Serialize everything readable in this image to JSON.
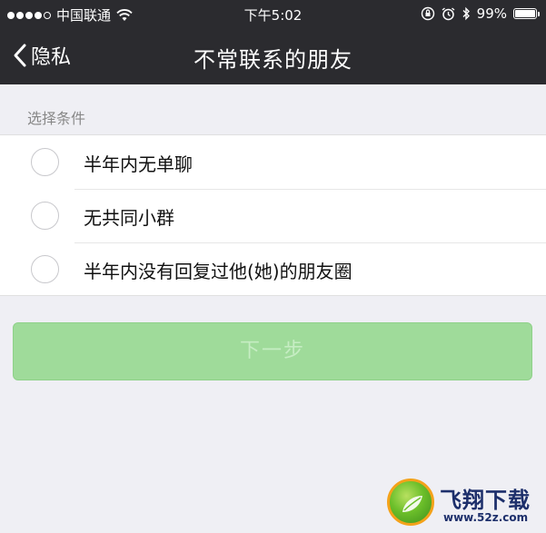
{
  "status_bar": {
    "carrier": "中国联通",
    "time": "下午5:02",
    "battery": "99%",
    "battery_level": 0.99,
    "signal_bars": 5,
    "signal_filled": 4,
    "icons": [
      "wifi-icon",
      "orientation-lock-icon",
      "alarm-icon",
      "bluetooth-icon",
      "battery-icon"
    ]
  },
  "nav": {
    "back_label": "隐私",
    "title": "不常联系的朋友"
  },
  "section": {
    "header": "选择条件",
    "options": [
      {
        "label": "半年内无单聊",
        "selected": false
      },
      {
        "label": "无共同小群",
        "selected": false
      },
      {
        "label": "半年内没有回复过他(她)的朋友圈",
        "selected": false
      }
    ]
  },
  "next_button": {
    "label": "下一步",
    "enabled": false
  },
  "watermark": {
    "text": "飞翔下载",
    "url": "www.52z.com"
  },
  "colors": {
    "bar_background": "#2b2b2f",
    "page_background": "#efeff4",
    "button_disabled": "#9fdb9a",
    "watermark_text": "#1d2f6b"
  }
}
